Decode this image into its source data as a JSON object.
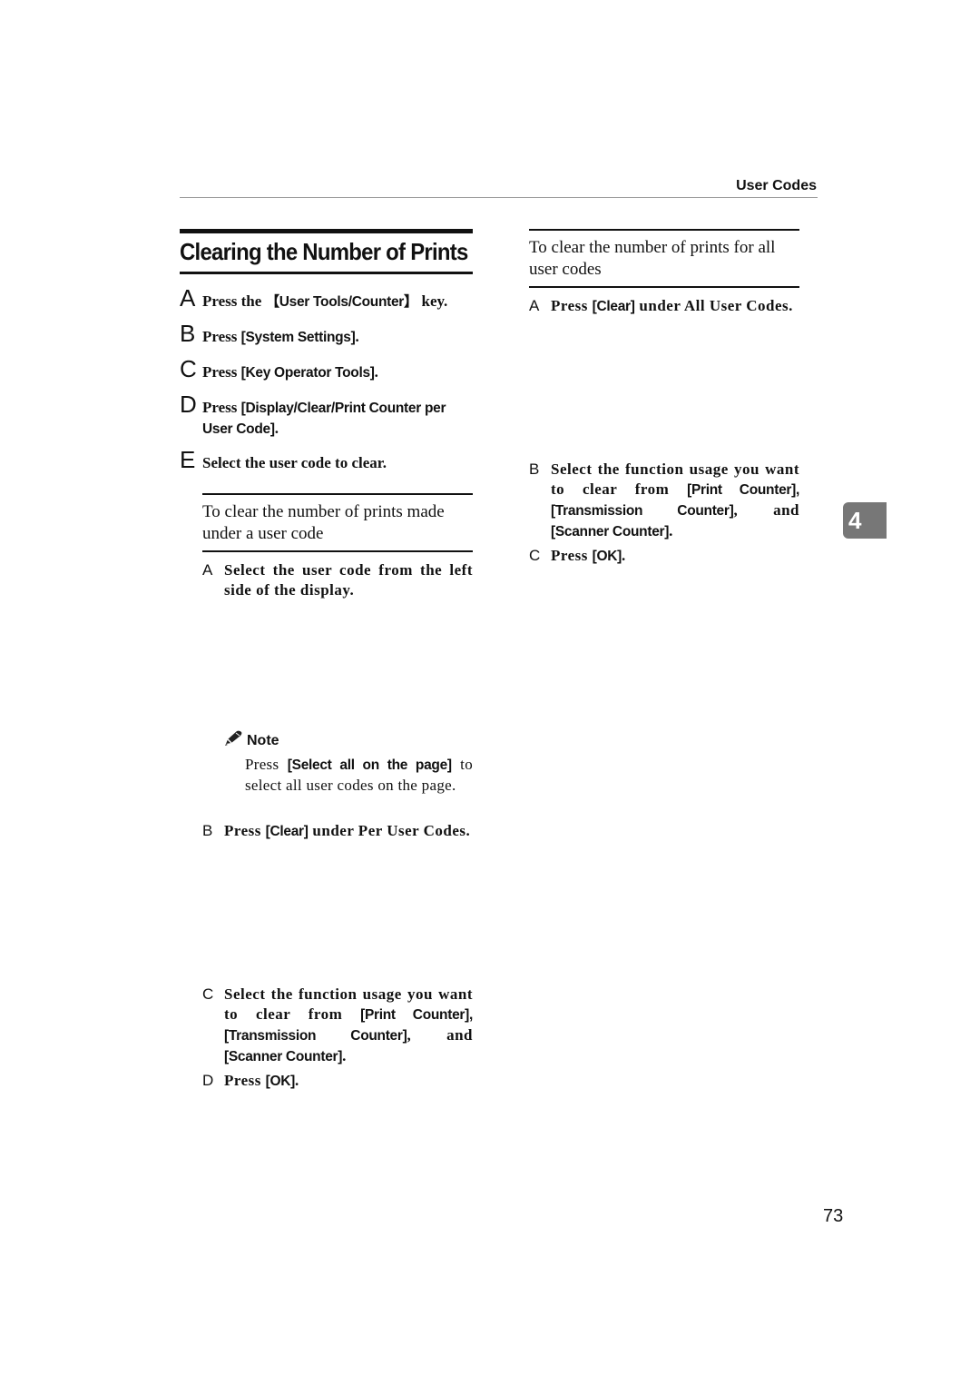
{
  "header": {
    "running_title": "User Codes"
  },
  "section": {
    "title": "Clearing the Number of Prints"
  },
  "steps": [
    {
      "letter": "A",
      "pre": "Press the ",
      "ui": "【User Tools/Counter】",
      "post": " key."
    },
    {
      "letter": "B",
      "pre": "Press ",
      "ui": "[System Settings]",
      "post": "."
    },
    {
      "letter": "C",
      "pre": "Press ",
      "ui": "[Key Operator Tools]",
      "post": "."
    },
    {
      "letter": "D",
      "pre": "Press ",
      "ui": "[Display/Clear/Print Counter per User Code]",
      "post": "."
    },
    {
      "letter": "E",
      "pre": "Select the user code to clear.",
      "ui": "",
      "post": ""
    }
  ],
  "per_user": {
    "heading": "To clear the number of prints made under a user code",
    "substeps": [
      {
        "letter": "A",
        "pre": "Select the user code from the left side of the display.",
        "ui": "",
        "post": ""
      },
      {
        "letter": "B",
        "pre": "Press ",
        "ui": "[Clear]",
        "post": " under Per User Codes."
      },
      {
        "letter": "C",
        "pre": "Select the function usage you want to clear from ",
        "ui": "[Print Counter], [Transmission Counter]",
        "post": ", and ",
        "ui2": "[Scanner Counter]",
        "post2": "."
      },
      {
        "letter": "D",
        "pre": "Press ",
        "ui": "[OK]",
        "post": "."
      }
    ],
    "note": {
      "icon": "pencil-icon",
      "title": "Note",
      "pre": "Press ",
      "ui": "[Select all on the page]",
      "post": " to select all user codes on the page."
    }
  },
  "all_users": {
    "heading": "To clear the number of prints for all user codes",
    "substeps": [
      {
        "letter": "A",
        "pre": "Press ",
        "ui": "[Clear]",
        "post": " under All User Codes."
      },
      {
        "letter": "B",
        "pre": "Select the function usage you want to clear from ",
        "ui": "[Print Counter], [Transmission Counter]",
        "post": ", and ",
        "ui2": "[Scanner Counter]",
        "post2": "."
      },
      {
        "letter": "C",
        "pre": "Press ",
        "ui": "[OK]",
        "post": "."
      }
    ]
  },
  "chapter_tab": "4",
  "page_number": "73"
}
